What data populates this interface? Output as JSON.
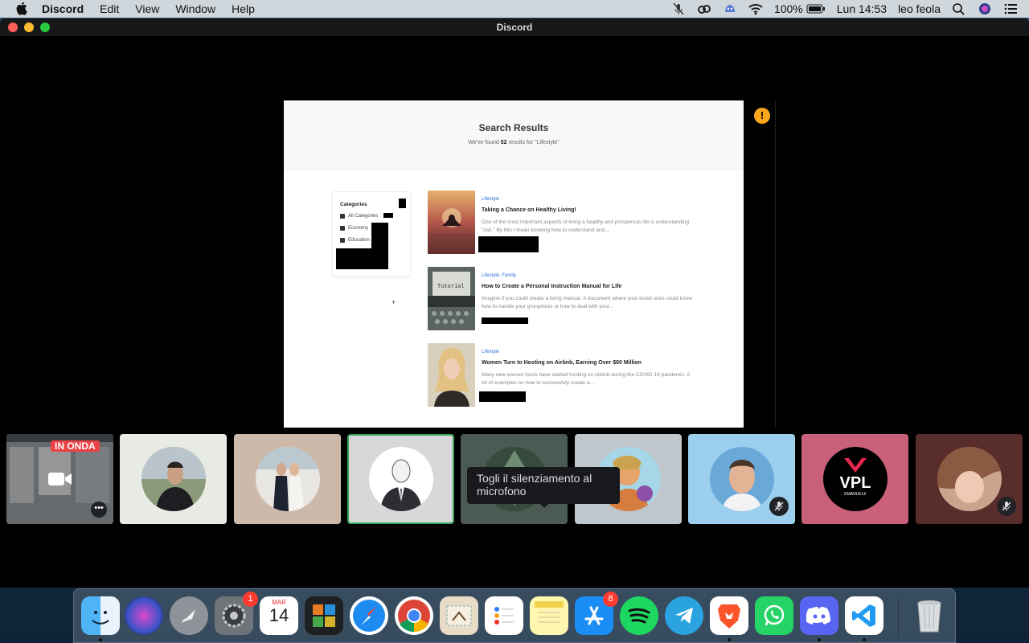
{
  "menubar": {
    "app_name": "Discord",
    "menus": [
      "Edit",
      "View",
      "Window",
      "Help"
    ],
    "battery": "100%",
    "datetime": "Lun 14:53",
    "user": "leo feola"
  },
  "window": {
    "title": "Discord"
  },
  "stream": {
    "heading": "Search Results",
    "sub_prefix": "We've found ",
    "count": "52",
    "sub_suffix": " results for \"Lifestyle\"",
    "categories_title": "Categories",
    "categories": [
      "All Categories",
      "Economy",
      "Education"
    ],
    "plus": "+",
    "posts": [
      {
        "category": "Lifestyle",
        "title": "Taking a Chance on Healthy Living!",
        "desc": "One of the most important aspects of living a healthy and prosperous life is understanding \"risk.\" By this I mean knowing how to understand and..."
      },
      {
        "category": "Lifestyle, Family",
        "title": "How to Create a Personal Instruction Manual for Life",
        "desc": "Imagine if you could create a living manual. A document where your loved ones could know how to handle your grunpiness or how to deal with your..."
      },
      {
        "category": "Lifestyle",
        "title": "Women Turn to Hosting on Airbnb, Earning Over $60 Million",
        "desc": "Many new women hosts have started hosting on Airbnb during the COVID-19 pandemic. A lot of examples on how to successfuly create a..."
      }
    ]
  },
  "warning_icon": "!",
  "live_label": "IN ONDA",
  "tile_more": "•••",
  "tooltip": "Togli il silenziamento al microfono",
  "vpl_logo": {
    "text": "VPL",
    "sub": "EMANUELE"
  },
  "dock": {
    "calendar_month": "MAR",
    "calendar_day": "14",
    "badges": {
      "system_preferences": "1",
      "app_store": "8"
    }
  }
}
